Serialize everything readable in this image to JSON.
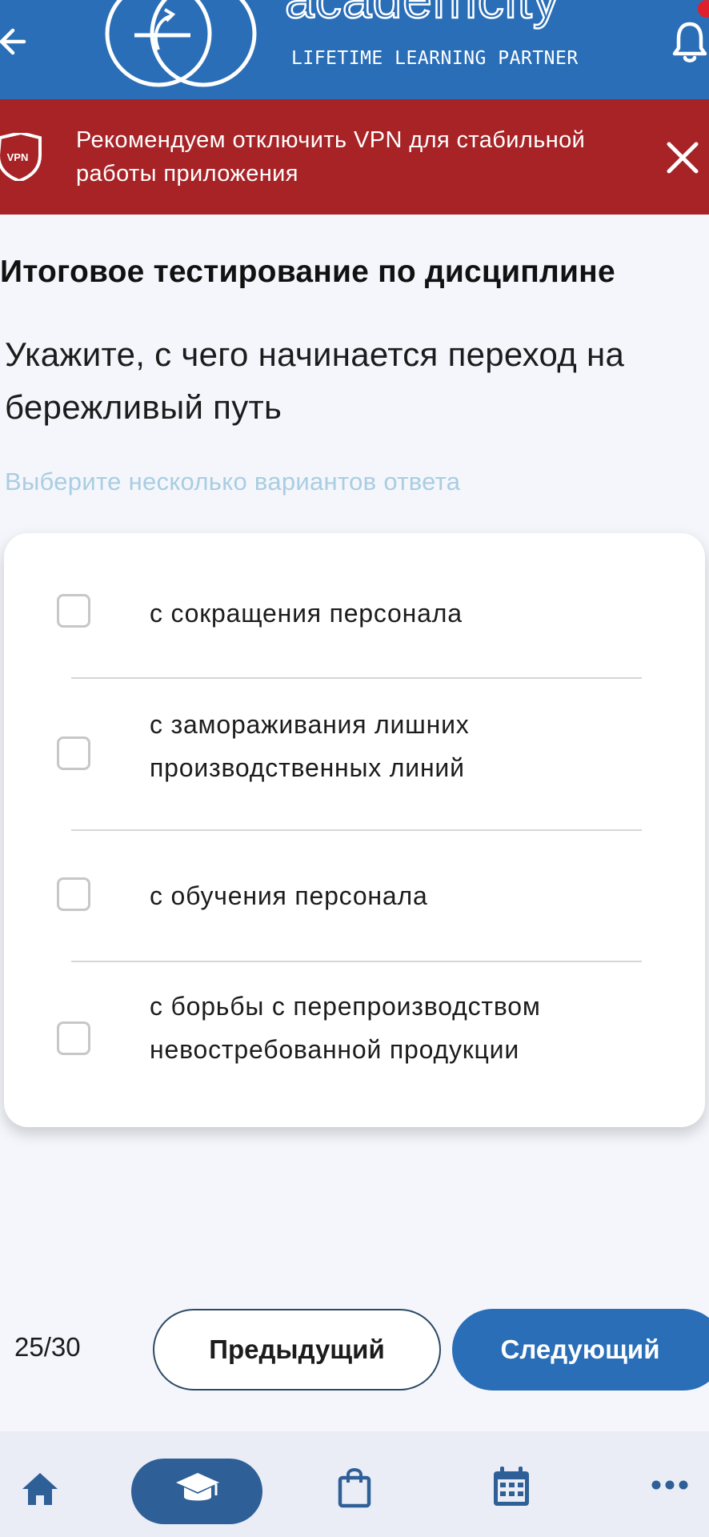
{
  "header": {
    "logo_name": "academcity",
    "logo_tagline": "LIFETIME LEARNING PARTNER"
  },
  "vpn_banner": {
    "badge": "VPN",
    "text": "Рекомендуем отключить VPN для стабильной работы приложения"
  },
  "test": {
    "title": "Итоговое тестирование по дисциплине",
    "question": "Укажите, с чего начинается переход на бережливый путь",
    "hint": "Выберите несколько вариантов ответа",
    "options": [
      {
        "label": "с сокращения персонала",
        "checked": false
      },
      {
        "label": "с замораживания лишних производственных линий",
        "checked": false
      },
      {
        "label": "с обучения персонала",
        "checked": false
      },
      {
        "label": "с борьбы с перепроизводством невостребованной продукции",
        "checked": false
      }
    ]
  },
  "pager": {
    "counter": "25/30",
    "prev_label": "Предыдущий",
    "next_label": "Следующий"
  },
  "tabbar": {
    "active": "courses",
    "items": [
      "home",
      "courses",
      "shop",
      "calendar",
      "more"
    ]
  },
  "colors": {
    "primary": "#2a6eb8",
    "banner": "#a72326",
    "hint": "#a9cde2",
    "active_tab": "#2f5f97"
  }
}
